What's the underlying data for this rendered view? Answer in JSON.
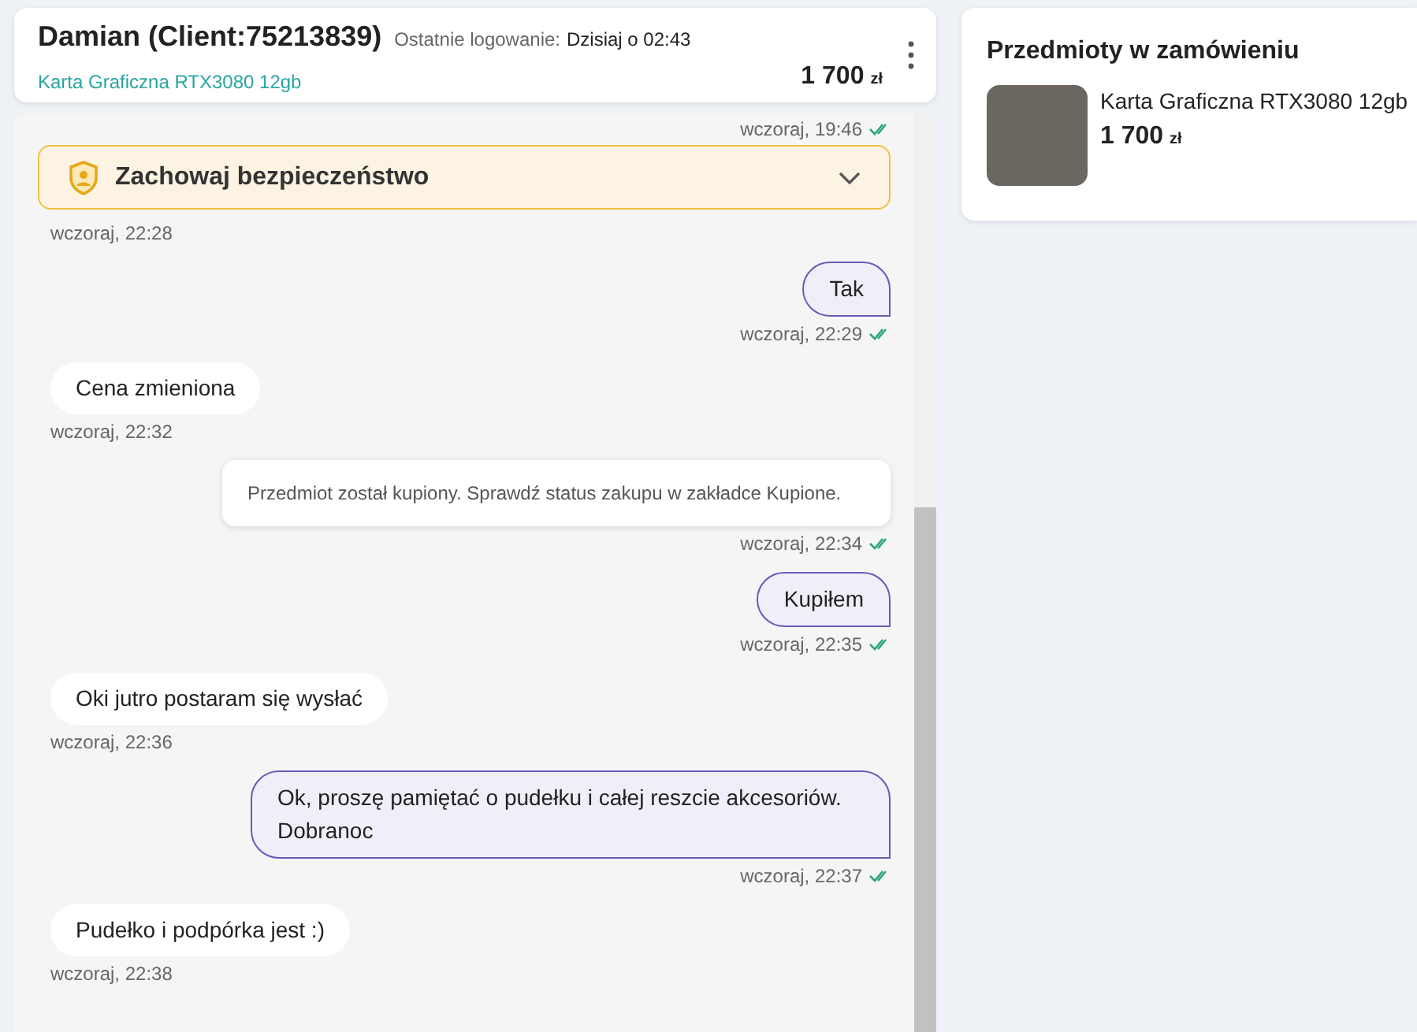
{
  "header": {
    "name": "Damian (Client:75213839)",
    "last_login_label": "Ostatnie logowanie:",
    "last_login_value": "Dzisiaj o 02:43",
    "product": "Karta Graficzna RTX3080 12gb",
    "price": "1 700",
    "currency": "zł"
  },
  "top_time": {
    "time": "wczoraj, 19:46",
    "read": true
  },
  "safety_banner": {
    "title": "Zachowaj bezpieczeństwo",
    "expanded": false
  },
  "messages": [
    {
      "kind": "time_only",
      "time": "wczoraj, 22:28"
    },
    {
      "kind": "out",
      "text": "Tak",
      "time": "wczoraj, 22:29",
      "read": true
    },
    {
      "kind": "in",
      "text": "Cena zmieniona",
      "time": "wczoraj, 22:32"
    },
    {
      "kind": "system",
      "text": "Przedmiot został kupiony. Sprawdź status zakupu w zakładce Kupione.",
      "time": "wczoraj, 22:34",
      "read": true
    },
    {
      "kind": "out",
      "text": "Kupiłem",
      "time": "wczoraj, 22:35",
      "read": true
    },
    {
      "kind": "in",
      "text": "Oki jutro postaram się wysłać",
      "time": "wczoraj, 22:36"
    },
    {
      "kind": "out",
      "text": "Ok, proszę pamiętać o pudełku i całej reszcie akcesoriów. Dobranoc",
      "time": "wczoraj, 22:37",
      "read": true
    },
    {
      "kind": "in",
      "text": "Pudełko i podpórka jest :)",
      "time": "wczoraj, 22:38"
    }
  ],
  "order": {
    "title": "Przedmioty w zamówieniu",
    "items": [
      {
        "name": "Karta Graficzna RTX3080 12gb",
        "price": "1 700",
        "currency": "zł"
      }
    ]
  }
}
